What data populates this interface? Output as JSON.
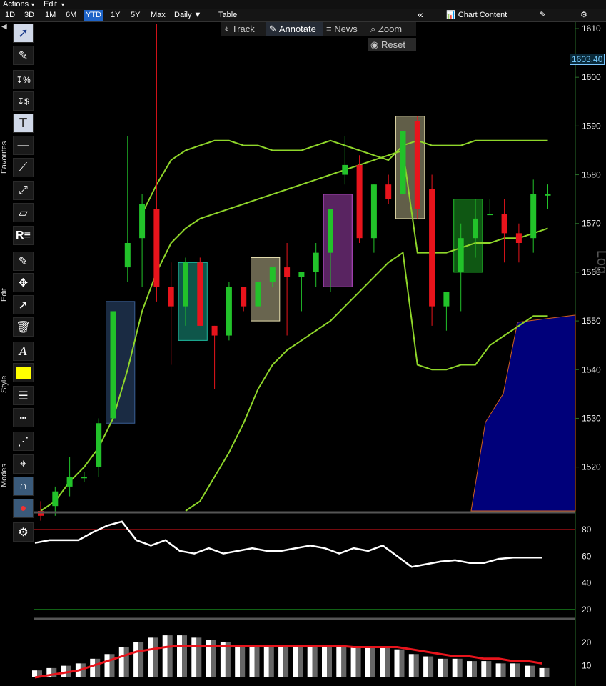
{
  "menu": {
    "actions": "Actions",
    "edit": "Edit"
  },
  "ranges": [
    "1D",
    "3D",
    "1M",
    "6M",
    "YTD",
    "1Y",
    "5Y",
    "Max"
  ],
  "active_range": "YTD",
  "period": "Daily",
  "table": "Table",
  "chart_content": "Chart Content",
  "annotate_toolbar": {
    "track": "Track",
    "annotate": "Annotate",
    "news": "News",
    "zoom": "Zoom",
    "reset": "Reset"
  },
  "sections": {
    "favorites": "Favorites",
    "edit": "Edit",
    "style": "Style",
    "modes": "Modes"
  },
  "price_label": "1603.40",
  "log_label": "Log",
  "colors": {
    "up": "#22c22a",
    "down": "#e8141c",
    "bollinger": "#8fd62a",
    "accent": "#1e64c8",
    "style_color": "#ffff00"
  },
  "chart_data": [
    {
      "type": "candlestick",
      "y_ticks": [
        1520,
        1530,
        1540,
        1550,
        1560,
        1570,
        1580,
        1590,
        1600,
        1610
      ],
      "ylim": [
        1511,
        1611
      ],
      "candles": [
        {
          "o": 1511,
          "h": 1513,
          "l": 1509,
          "c": 1510
        },
        {
          "o": 1512,
          "h": 1516,
          "l": 1510,
          "c": 1515
        },
        {
          "o": 1516,
          "h": 1522,
          "l": 1514,
          "c": 1518
        },
        {
          "o": 1518,
          "h": 1519,
          "l": 1517,
          "c": 1518
        },
        {
          "o": 1520,
          "h": 1530,
          "l": 1518,
          "c": 1529
        },
        {
          "o": 1530,
          "h": 1554,
          "l": 1528,
          "c": 1552
        },
        {
          "o": 1561,
          "h": 1588,
          "l": 1558,
          "c": 1566
        },
        {
          "o": 1567,
          "h": 1576,
          "l": 1557,
          "c": 1574
        },
        {
          "o": 1573,
          "h": 1639,
          "l": 1554,
          "c": 1557
        },
        {
          "o": 1557,
          "h": 1562,
          "l": 1541,
          "c": 1553
        },
        {
          "o": 1553,
          "h": 1563,
          "l": 1549,
          "c": 1562
        },
        {
          "o": 1562,
          "h": 1563,
          "l": 1549,
          "c": 1549
        },
        {
          "o": 1549,
          "h": 1549,
          "l": 1536,
          "c": 1547
        },
        {
          "o": 1547,
          "h": 1558,
          "l": 1546,
          "c": 1557
        },
        {
          "o": 1557,
          "h": 1557,
          "l": 1552,
          "c": 1553
        },
        {
          "o": 1553,
          "h": 1562,
          "l": 1551,
          "c": 1558
        },
        {
          "o": 1558,
          "h": 1561,
          "l": 1557,
          "c": 1561
        },
        {
          "o": 1561,
          "h": 1566,
          "l": 1547,
          "c": 1559
        },
        {
          "o": 1559,
          "h": 1560,
          "l": 1552,
          "c": 1560
        },
        {
          "o": 1560,
          "h": 1566,
          "l": 1557,
          "c": 1564
        },
        {
          "o": 1564,
          "h": 1573,
          "l": 1556,
          "c": 1573
        },
        {
          "o": 1580,
          "h": 1588,
          "l": 1578,
          "c": 1582
        },
        {
          "o": 1582,
          "h": 1584,
          "l": 1566,
          "c": 1567
        },
        {
          "o": 1567,
          "h": 1578,
          "l": 1564,
          "c": 1578
        },
        {
          "o": 1578,
          "h": 1580,
          "l": 1574,
          "c": 1575
        },
        {
          "o": 1576,
          "h": 1592,
          "l": 1571,
          "c": 1589
        },
        {
          "o": 1591,
          "h": 1592,
          "l": 1571,
          "c": 1573
        },
        {
          "o": 1577,
          "h": 1580,
          "l": 1549,
          "c": 1553
        },
        {
          "o": 1553,
          "h": 1556,
          "l": 1548,
          "c": 1556
        },
        {
          "o": 1560,
          "h": 1570,
          "l": 1552,
          "c": 1567
        },
        {
          "o": 1567,
          "h": 1575,
          "l": 1563,
          "c": 1571
        },
        {
          "o": 1572,
          "h": 1575,
          "l": 1572,
          "c": 1572
        },
        {
          "o": 1572,
          "h": 1575,
          "l": 1562,
          "c": 1568
        },
        {
          "o": 1568,
          "h": 1570,
          "l": 1562,
          "c": 1566
        },
        {
          "o": 1567,
          "h": 1579,
          "l": 1564,
          "c": 1576
        },
        {
          "o": 1576,
          "h": 1578,
          "l": 1573,
          "c": 1576
        }
      ],
      "bands": {
        "upper": [
          null,
          null,
          null,
          null,
          null,
          null,
          null,
          1572,
          1578,
          1583,
          1585,
          1586,
          1587,
          1587,
          1586,
          1586,
          1585,
          1585,
          1585,
          1586,
          1587,
          1586,
          1585,
          1584,
          1583,
          1586,
          1587,
          1586,
          1586,
          1586,
          1587,
          1587,
          1587,
          1587,
          1587,
          1587
        ],
        "middle": [
          1511,
          1513,
          1517,
          1520,
          1524,
          1530,
          1540,
          1552,
          1560,
          1566,
          1569,
          1571,
          1572,
          1573,
          1574,
          1575,
          1576,
          1577,
          1578,
          1579,
          1580,
          1581,
          1582,
          1583,
          1584,
          1585,
          1564,
          1564,
          1564,
          1565,
          1566,
          1566,
          1567,
          1567,
          1568,
          1569
        ],
        "lower": [
          null,
          null,
          null,
          null,
          null,
          null,
          null,
          null,
          null,
          null,
          1511,
          1513,
          1518,
          1523,
          1529,
          1536,
          1541,
          1544,
          1546,
          1548,
          1550,
          1553,
          1556,
          1559,
          1562,
          1564,
          1541,
          1540,
          1540,
          1541,
          1541,
          1545,
          1547,
          1549,
          1551,
          1551
        ]
      },
      "boxes": [
        {
          "from": 5,
          "to": 6,
          "top": 1554,
          "bottom": 1529,
          "color": "#3a5f95"
        },
        {
          "from": 10,
          "to": 11,
          "top": 1562,
          "bottom": 1546,
          "color": "#1fbfa3"
        },
        {
          "from": 15,
          "to": 16,
          "top": 1563,
          "bottom": 1550,
          "color": "#e8e0b0"
        },
        {
          "from": 20,
          "to": 21,
          "top": 1576,
          "bottom": 1557,
          "color": "#c54fd8"
        },
        {
          "from": 25,
          "to": 26,
          "top": 1592,
          "bottom": 1571,
          "color": "#d8d0a0"
        },
        {
          "from": 29,
          "to": 30,
          "top": 1575,
          "bottom": 1560,
          "color": "#22c22a"
        }
      ]
    },
    {
      "type": "line",
      "name": "RSI",
      "y_ticks": [
        20,
        40,
        60,
        80
      ],
      "ylim": [
        15,
        92
      ],
      "values": [
        70,
        72,
        72,
        72,
        78,
        83,
        86,
        72,
        68,
        72,
        64,
        62,
        66,
        62,
        64,
        66,
        64,
        64,
        66,
        68,
        66,
        62,
        66,
        64,
        68,
        60,
        52,
        54,
        56,
        57,
        55,
        55,
        58,
        59,
        59,
        59
      ]
    },
    {
      "type": "bar",
      "name": "MACD",
      "y_ticks": [
        10,
        20
      ],
      "ylim": [
        5,
        28
      ],
      "values": [
        8,
        9,
        10,
        11,
        13,
        15,
        18,
        20,
        22,
        23,
        23,
        22,
        21,
        20,
        19,
        19,
        18,
        18,
        18,
        18,
        18,
        18,
        18,
        18,
        18,
        17,
        15,
        14,
        13,
        13,
        12,
        12,
        11,
        11,
        10,
        9
      ],
      "signal": [
        5,
        6,
        7,
        8,
        10,
        12,
        14,
        16,
        17,
        18,
        18.5,
        18.5,
        18.5,
        18.5,
        18.5,
        18.5,
        18.5,
        18.5,
        18.5,
        18.5,
        18.5,
        18.5,
        18,
        18,
        18,
        18,
        17,
        16,
        15,
        14,
        14,
        13,
        13,
        12,
        12,
        11
      ]
    }
  ]
}
